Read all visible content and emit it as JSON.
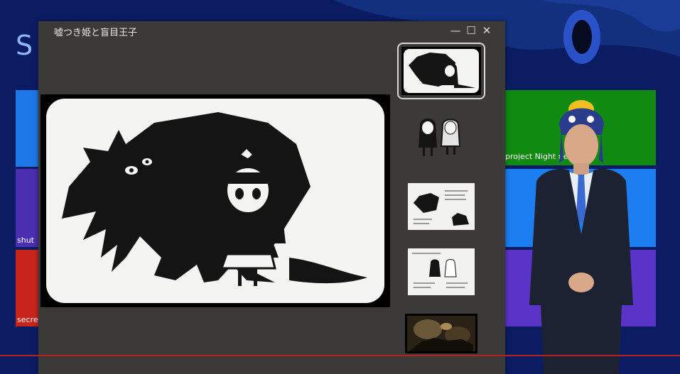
{
  "window": {
    "title": "嘘つき姫と盲目王子",
    "minimize_glyph": "—",
    "maximize_glyph": "☐",
    "close_glyph": "✕"
  },
  "background": {
    "heading_partial": "S",
    "tile_labels": {
      "green": "project Night ne",
      "purple": "shut",
      "red": "secre"
    }
  },
  "gallery": {
    "thumbnail_count": 5,
    "selected_index": 0
  },
  "colors": {
    "window_bg": "#3c3a38",
    "tile_green": "#108a10",
    "tile_blue": "#1e78e8",
    "tile_purple": "#4a2fb0",
    "tile_red": "#c8241c"
  }
}
